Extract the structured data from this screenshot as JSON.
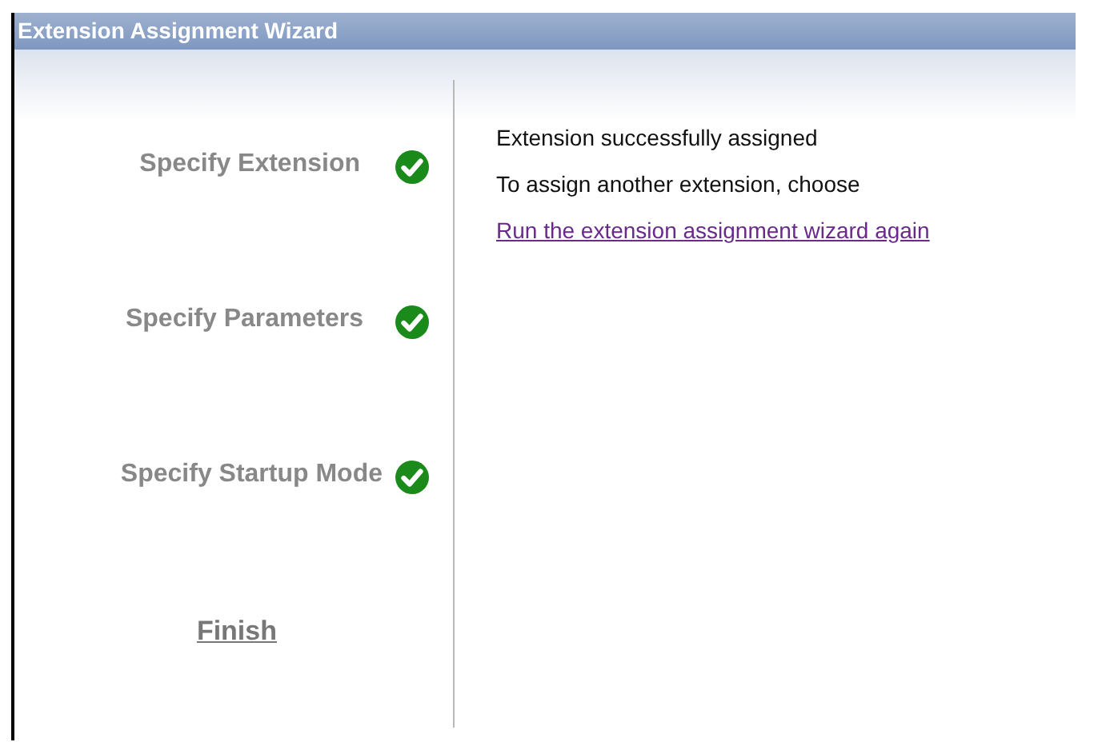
{
  "window": {
    "title": "Extension Assignment Wizard"
  },
  "steps": [
    {
      "kind": "step",
      "label": "Specify Extension",
      "completed": true
    },
    {
      "kind": "step",
      "label": "Specify Parameters",
      "completed": true
    },
    {
      "kind": "step",
      "label": "Specify Startup Mode",
      "completed": true
    },
    {
      "kind": "link",
      "label": "Finish",
      "completed": false
    }
  ],
  "messages": [
    "Extension successfully assigned",
    "To assign another extension, choose"
  ],
  "link": "Run the extension assignment wizard again"
}
